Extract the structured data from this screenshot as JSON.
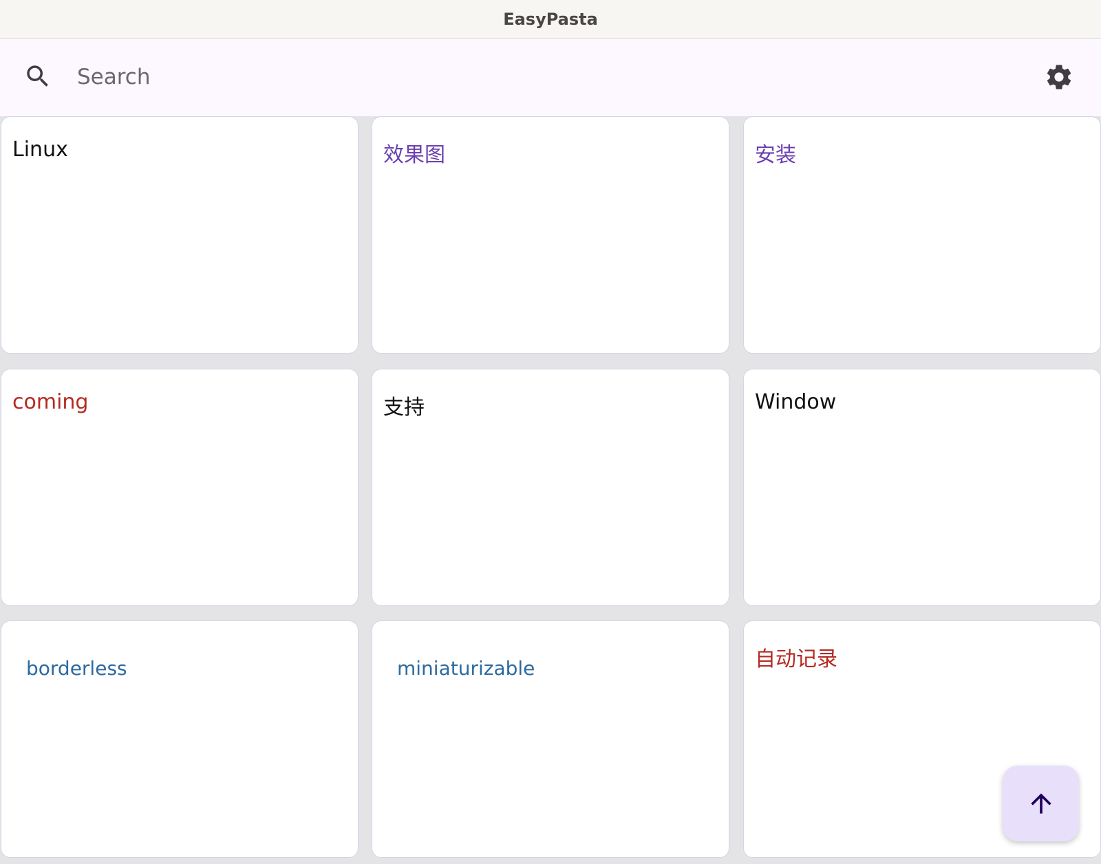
{
  "window": {
    "title": "EasyPasta"
  },
  "toolbar": {
    "search_placeholder": "Search",
    "search_value": "",
    "search_icon": "search-icon",
    "settings_icon": "gear-icon"
  },
  "clips": [
    {
      "text": "Linux",
      "color": "#111111"
    },
    {
      "text": "效果图",
      "color": "#6b3fb0"
    },
    {
      "text": "安装",
      "color": "#6b3fb0"
    },
    {
      "text": "coming",
      "color": "#b52a22"
    },
    {
      "text": "支持",
      "color": "#111111"
    },
    {
      "text": "Window",
      "color": "#111111"
    },
    {
      "text": "borderless",
      "color": "#2d6aa0"
    },
    {
      "text": "miniaturizable",
      "color": "#2d6aa0"
    },
    {
      "text": "自动记录",
      "color": "#b52a22"
    }
  ],
  "fab": {
    "icon": "arrow-up-icon"
  },
  "colors": {
    "titlebar_bg": "#f8f6f2",
    "toolbar_bg": "#fdf8ff",
    "grid_bg": "#e4e4e6",
    "card_border": "#cfd6e6",
    "fab_bg": "#e8e0fb",
    "fab_icon": "#21005d"
  }
}
